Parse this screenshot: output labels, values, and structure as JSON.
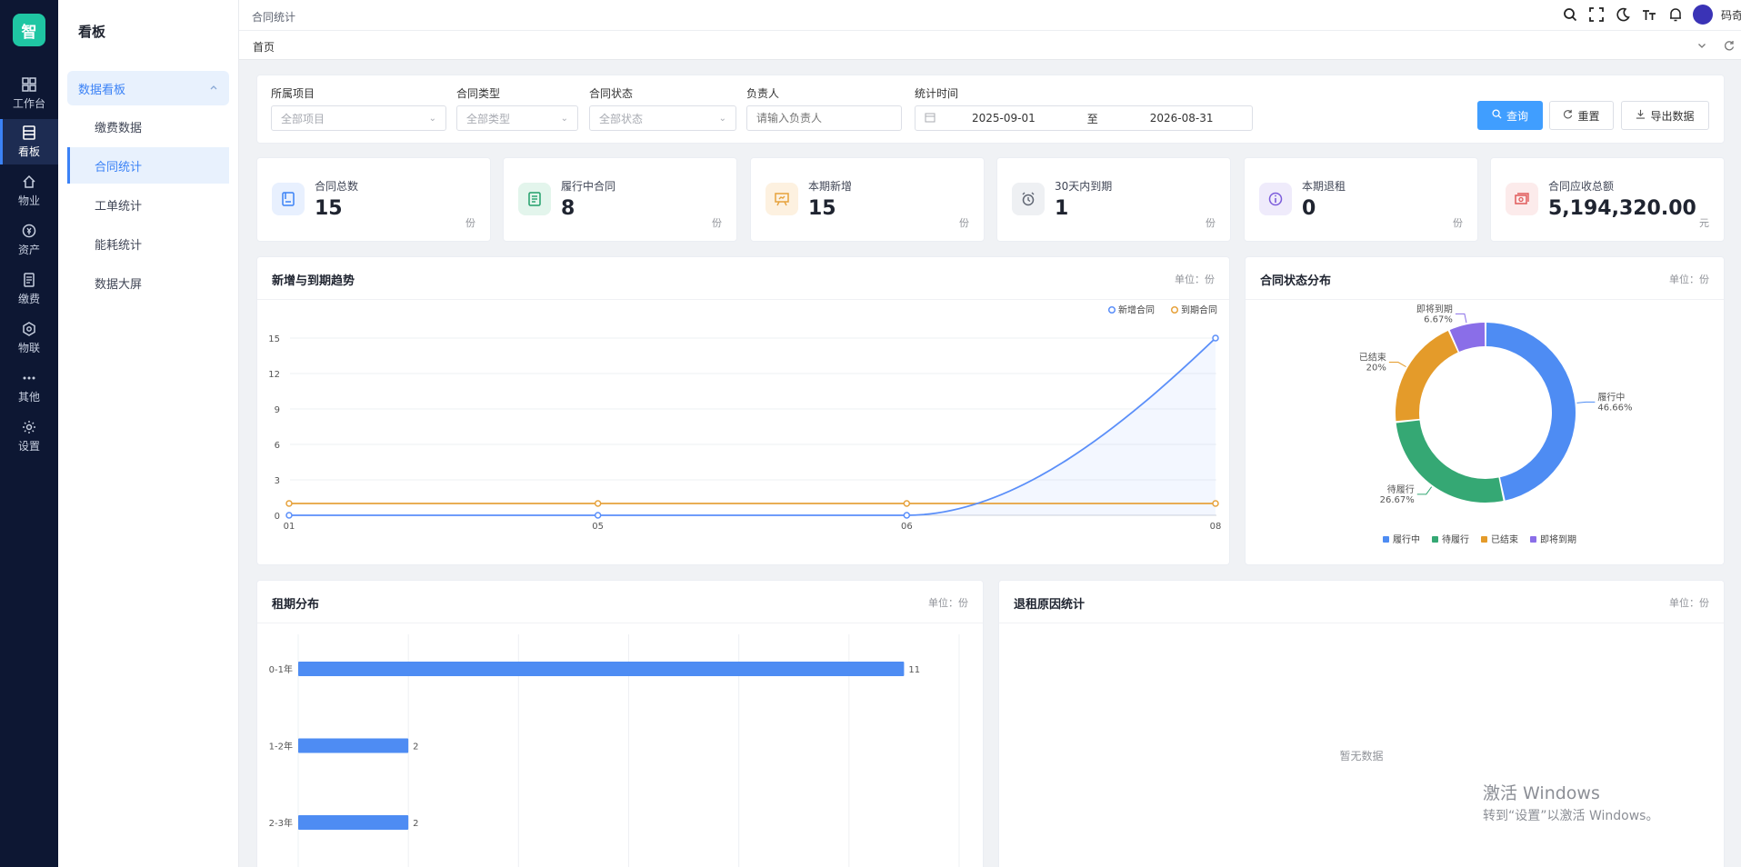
{
  "app": {
    "logo_text": "智",
    "brand_color": "#1fc6a3",
    "accent_color": "#409eff"
  },
  "rail": [
    {
      "label": "工作台",
      "icon": "grid-icon"
    },
    {
      "label": "看板",
      "icon": "dashboard-icon",
      "active": true
    },
    {
      "label": "物业",
      "icon": "home-icon"
    },
    {
      "label": "资产",
      "icon": "asset-icon"
    },
    {
      "label": "缴费",
      "icon": "bill-icon"
    },
    {
      "label": "物联",
      "icon": "iot-icon"
    },
    {
      "label": "其他",
      "icon": "more-icon"
    },
    {
      "label": "设置",
      "icon": "gear-icon"
    }
  ],
  "submenu": {
    "title": "看板",
    "group": "数据看板",
    "items": [
      "缴费数据",
      "合同统计",
      "工单统计",
      "能耗统计",
      "数据大屏"
    ],
    "active_index": 1
  },
  "topbar": {
    "breadcrumb": "合同统计",
    "user": "码奇"
  },
  "tabs": {
    "home": "首页"
  },
  "filters": {
    "project": {
      "label": "所属项目",
      "value": "全部项目"
    },
    "type": {
      "label": "合同类型",
      "value": "全部类型"
    },
    "status": {
      "label": "合同状态",
      "value": "全部状态"
    },
    "owner": {
      "label": "负责人",
      "placeholder": "请输入负责人"
    },
    "period": {
      "label": "统计时间",
      "start": "2025-09-01",
      "sep": "至",
      "end": "2026-08-31"
    },
    "query": "查询",
    "reset": "重置",
    "export": "导出数据"
  },
  "stats": [
    {
      "label": "合同总数",
      "value": "15",
      "unit": "份",
      "icon": "contract-icon",
      "color": "#3b82f6"
    },
    {
      "label": "履行中合同",
      "value": "8",
      "unit": "份",
      "icon": "document-icon",
      "color": "#22a06b"
    },
    {
      "label": "本期新增",
      "value": "15",
      "unit": "份",
      "icon": "presentation-icon",
      "color": "#e6a23c"
    },
    {
      "label": "30天内到期",
      "value": "1",
      "unit": "份",
      "icon": "alarm-icon",
      "color": "#606673"
    },
    {
      "label": "本期退租",
      "value": "0",
      "unit": "份",
      "icon": "info-icon",
      "color": "#7c5cdb"
    },
    {
      "label": "合同应收总额",
      "value": "5,194,320.00",
      "unit": "元",
      "icon": "cash-icon",
      "color": "#e05a5a"
    }
  ],
  "trend_card": {
    "title": "新增与到期趋势",
    "unit": "单位：份"
  },
  "pie_card": {
    "title": "合同状态分布",
    "unit": "单位：份"
  },
  "lease_card": {
    "title": "租期分布",
    "unit": "单位：份"
  },
  "reason_card": {
    "title": "退租原因统计",
    "unit": "单位：份",
    "empty": "暂无数据"
  },
  "chart_data": [
    {
      "type": "line",
      "x": [
        "01",
        "05",
        "06",
        "08"
      ],
      "ylim": [
        0,
        15
      ],
      "yticks": [
        0,
        3,
        6,
        9,
        12,
        15
      ],
      "legend_position": "top-right",
      "series": [
        {
          "name": "新增合同",
          "values": [
            0,
            0,
            0,
            15
          ],
          "color": "#5b8ff9"
        },
        {
          "name": "到期合同",
          "values": [
            1,
            1,
            1,
            1
          ],
          "color": "#e6a23c"
        }
      ]
    },
    {
      "type": "pie",
      "legend_position": "bottom",
      "slices": [
        {
          "name": "履行中",
          "value": 46.66,
          "label": "46.66%",
          "color": "#4e8cf3"
        },
        {
          "name": "待履行",
          "value": 26.67,
          "label": "26.67%",
          "color": "#35a874"
        },
        {
          "name": "已结束",
          "value": 20,
          "label": "20%",
          "color": "#e49b2a"
        },
        {
          "name": "即将到期",
          "value": 6.67,
          "label": "6.67%",
          "color": "#8a6ee8"
        }
      ]
    },
    {
      "type": "bar",
      "orientation": "horizontal",
      "categories": [
        "0-1年",
        "1-2年",
        "2-3年"
      ],
      "values": [
        11,
        2,
        2
      ],
      "xlim": [
        0,
        12
      ],
      "color": "#4e8cf3"
    }
  ],
  "watermark": {
    "line1": "激活 Windows",
    "line2": "转到“设置”以激活 Windows。"
  }
}
